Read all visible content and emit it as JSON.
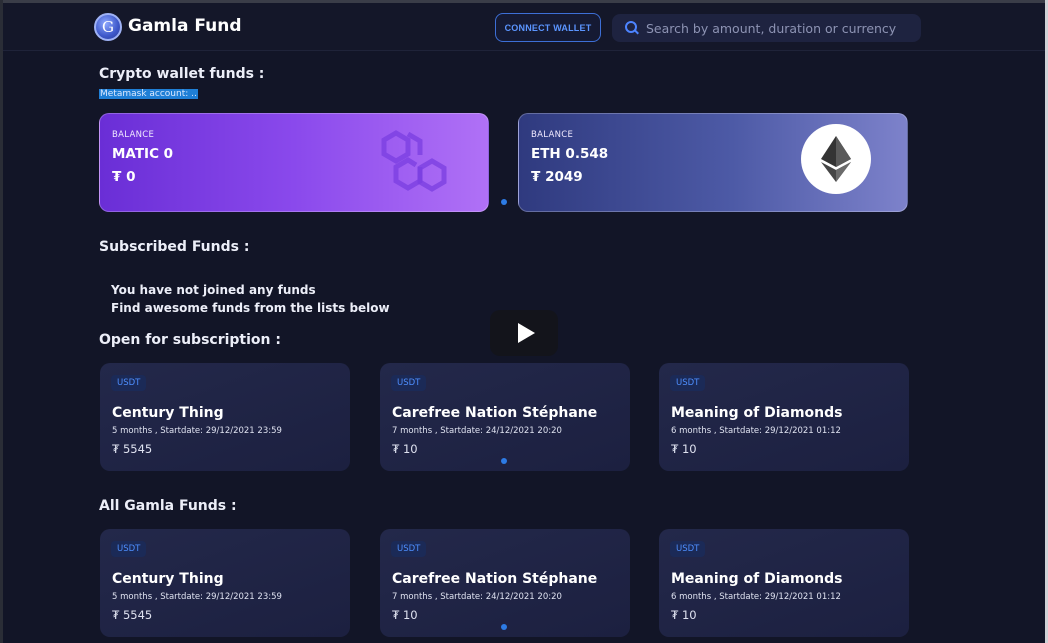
{
  "header": {
    "brand": "Gamla Fund",
    "logo_letter": "G",
    "connect_label": "CONNECT WALLET",
    "search_placeholder": "Search by amount, duration or currency"
  },
  "wallet_section": {
    "title": "Crypto wallet funds :",
    "account": "Metamask account: ..",
    "cards": [
      {
        "label": "BALANCE",
        "balance": "MATIC 0",
        "fiat": "₮ 0",
        "icon": "polygon-icon"
      },
      {
        "label": "BALANCE",
        "balance": "ETH 0.548",
        "fiat": "₮ 2049",
        "icon": "ethereum-icon"
      }
    ]
  },
  "subscribed": {
    "title": "Subscribed Funds :",
    "line1": "You have not joined any funds",
    "line2": "Find awesome funds from the lists below"
  },
  "open_section": {
    "title": "Open for subscription :",
    "funds": [
      {
        "currency": "USDT",
        "name": "Century Thing",
        "meta": "5 months , Startdate: 29/12/2021 23:59",
        "amount": "₮ 5545"
      },
      {
        "currency": "USDT",
        "name": "Carefree Nation Stéphane",
        "meta": "7 months , Startdate: 24/12/2021 20:20",
        "amount": "₮ 10"
      },
      {
        "currency": "USDT",
        "name": "Meaning of Diamonds",
        "meta": "6 months , Startdate: 29/12/2021 01:12",
        "amount": "₮ 10"
      }
    ]
  },
  "all_section": {
    "title": "All Gamla Funds :",
    "funds": [
      {
        "currency": "USDT",
        "name": "Century Thing",
        "meta": "5 months , Startdate: 29/12/2021 23:59",
        "amount": "₮ 5545"
      },
      {
        "currency": "USDT",
        "name": "Carefree Nation Stéphane",
        "meta": "7 months , Startdate: 24/12/2021 20:20",
        "amount": "₮ 10"
      },
      {
        "currency": "USDT",
        "name": "Meaning of Diamonds",
        "meta": "6 months , Startdate: 29/12/2021 01:12",
        "amount": "₮ 10"
      }
    ]
  },
  "colors": {
    "accent": "#2d7be5",
    "matic_gradient_start": "#6a2ed6",
    "eth_gradient_start": "#2f3a7f"
  }
}
